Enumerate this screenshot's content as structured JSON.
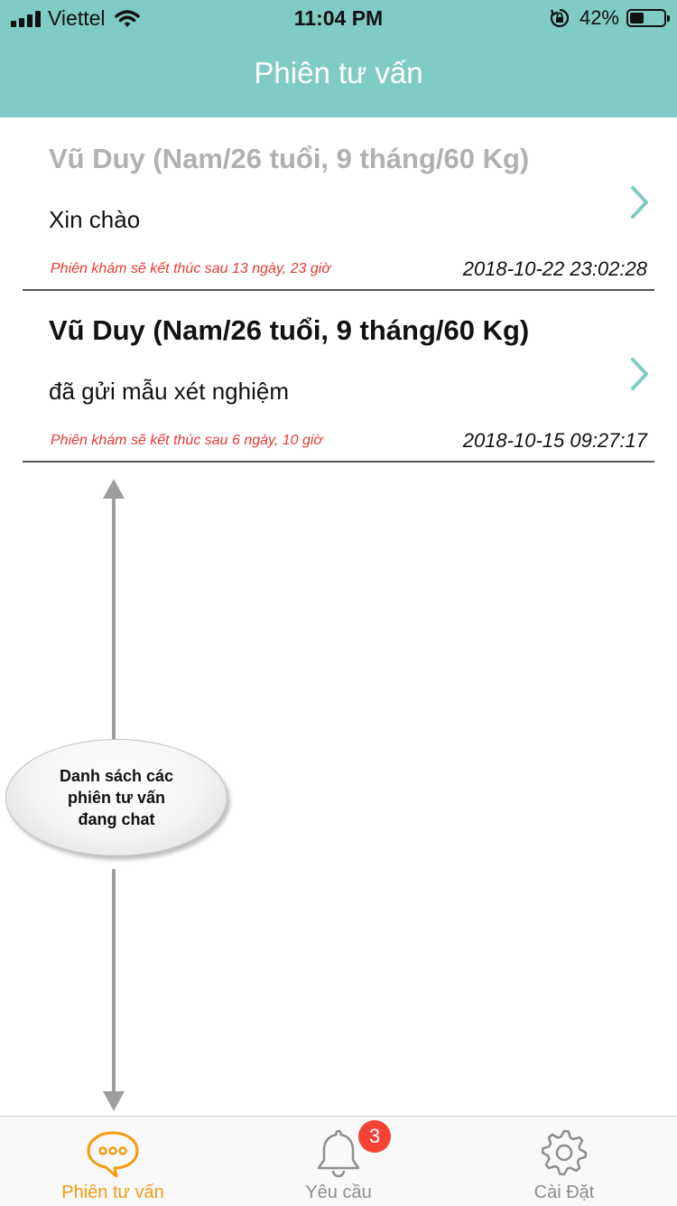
{
  "status_bar": {
    "carrier": "Viettel",
    "time": "11:04 PM",
    "battery": "42%",
    "battery_level": 0.42
  },
  "header": {
    "title": "Phiên tư vấn"
  },
  "sessions": [
    {
      "name": "Vũ Duy (Nam/26 tuổi, 9 tháng/60 Kg)",
      "message": "Xin chào",
      "expiry": "Phiên khám sẽ kết thúc sau 13 ngày, 23 giờ",
      "timestamp": "2018-10-22 23:02:28",
      "read": true
    },
    {
      "name": "Vũ Duy (Nam/26 tuổi, 9 tháng/60 Kg)",
      "message": "đã gửi mẫu xét nghiệm",
      "expiry": "Phiên khám sẽ kết thúc sau 6 ngày, 10 giờ",
      "timestamp": "2018-10-15 09:27:17",
      "read": false
    }
  ],
  "annotation": {
    "lines": [
      "Danh sách các",
      "phiên tư vấn",
      "đang chat"
    ]
  },
  "tabs": [
    {
      "label": "Phiên tư vấn",
      "icon": "chat-bubble-icon",
      "active": true
    },
    {
      "label": "Yêu cầu",
      "icon": "bell-icon",
      "active": false,
      "badge": "3"
    },
    {
      "label": "Cài Đặt",
      "icon": "gear-icon",
      "active": false
    }
  ],
  "colors": {
    "accent": "#80CBC4",
    "tab_active": "#F39C12",
    "tab_inactive": "#8E8E8E",
    "expiry_text": "#E53935",
    "badge": "#F44336"
  }
}
